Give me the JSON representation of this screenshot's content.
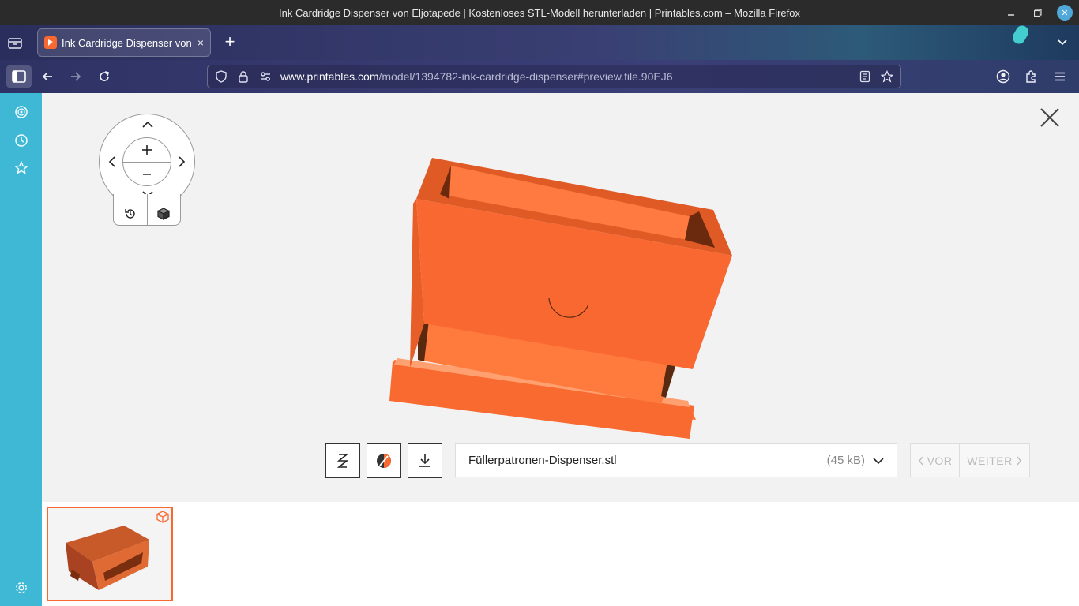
{
  "window": {
    "title": "Ink Cardridge Dispenser von Eljotapede | Kostenloses STL-Modell herunterladen | Printables.com – Mozilla Firefox"
  },
  "tab": {
    "title": "Ink Cardridge Dispenser von Eljotapede | Kostenloses STL-Modell herunterladen | Printables.com",
    "close": "×",
    "new": "+"
  },
  "url": {
    "host": "www.printables.com",
    "path": "/model/1394782-ink-cardridge-dispenser#preview.file.90EJ6"
  },
  "viewer": {
    "file_name": "Füllerpatronen-Dispenser.stl",
    "file_size": "(45 kB)",
    "prev_label": "VOR",
    "next_label": "WEITER"
  },
  "colors": {
    "accent": "#fa6831",
    "sidebar": "#3fb8d6"
  }
}
